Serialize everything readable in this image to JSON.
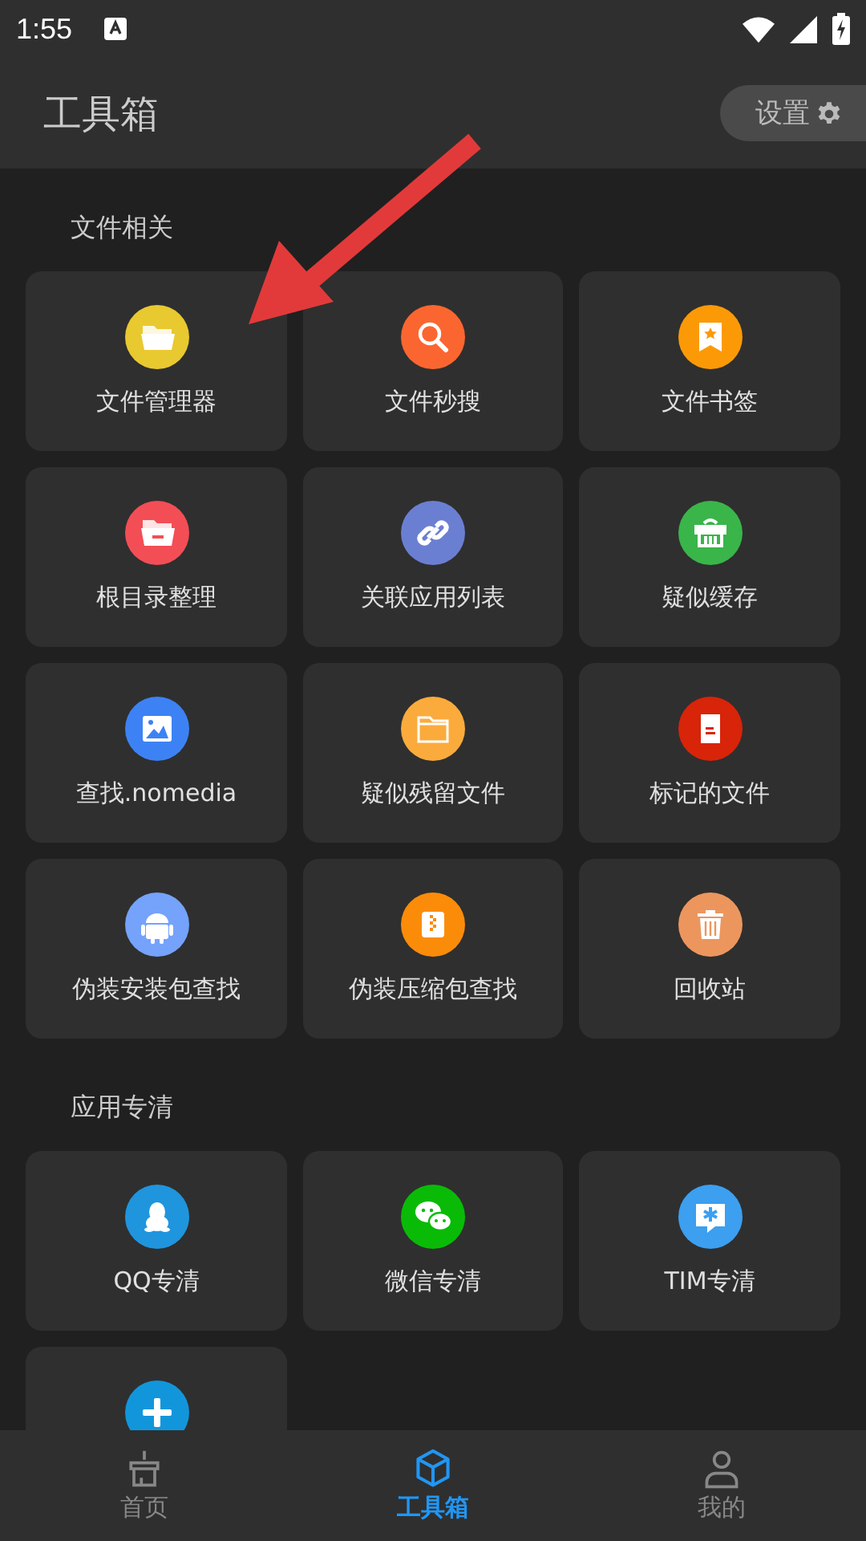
{
  "status_bar": {
    "time": "1:55"
  },
  "app_bar": {
    "title": "工具箱",
    "settings_label": "设置"
  },
  "sections": [
    {
      "title": "文件相关",
      "tools": [
        {
          "label": "文件管理器",
          "kind": "folder",
          "color": "#e8c930"
        },
        {
          "label": "文件秒搜",
          "kind": "search",
          "color": "#fb6630"
        },
        {
          "label": "文件书签",
          "kind": "bookmark",
          "color": "#fb9a06"
        },
        {
          "label": "根目录整理",
          "kind": "folder-minus",
          "color": "#f34e55"
        },
        {
          "label": "关联应用列表",
          "kind": "link",
          "color": "#6b7fd2"
        },
        {
          "label": "疑似缓存",
          "kind": "basket",
          "color": "#3ab54a"
        },
        {
          "label": "查找.nomedia",
          "kind": "image",
          "color": "#3d82f5"
        },
        {
          "label": "疑似残留文件",
          "kind": "folder-outline",
          "color": "#fbab3c"
        },
        {
          "label": "标记的文件",
          "kind": "document",
          "color": "#d82409"
        },
        {
          "label": "伪装安装包查找",
          "kind": "android",
          "color": "#75a2fb"
        },
        {
          "label": "伪装压缩包查找",
          "kind": "zip",
          "color": "#fb8c0a"
        },
        {
          "label": "回收站",
          "kind": "trash",
          "color": "#ec965e"
        }
      ]
    },
    {
      "title": "应用专清",
      "tools": [
        {
          "label": "QQ专清",
          "kind": "penguin",
          "color": "#1f95de"
        },
        {
          "label": "微信专清",
          "kind": "chat",
          "color": "#09bb07"
        },
        {
          "label": "TIM专清",
          "kind": "star-chat",
          "color": "#3c9ff0"
        },
        {
          "kind": "plus",
          "color": "#1296db"
        }
      ]
    }
  ],
  "bottom_nav": [
    {
      "label": "首页",
      "kind": "broom",
      "selected": false
    },
    {
      "label": "工具箱",
      "kind": "cube",
      "selected": true
    },
    {
      "label": "我的",
      "kind": "person",
      "selected": false
    }
  ]
}
